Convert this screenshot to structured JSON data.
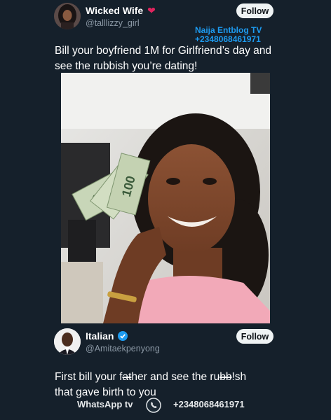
{
  "tweet": {
    "user_name": "Wicked Wife",
    "user_emoji": "❤️",
    "handle": "@talllizzy_girl",
    "follow_label": "Follow",
    "text": "Bill your boyfriend 1M for Girlfriend’s day and see the rubbish you’re dating!"
  },
  "watermark": {
    "line1": "Naija Entblog TV",
    "line2": "+2348068461971"
  },
  "reply": {
    "user_name": "Italian",
    "handle": "@Amitaekpenyong",
    "follow_label": "Follow",
    "text_part1": "First bill your f",
    "text_strike1": "at",
    "text_part2": "her and see the ru",
    "text_strike2": "bb",
    "text_part3": "!sh that gave birth to you"
  },
  "footer": {
    "left_label": "WhatsApp tv",
    "phone": "+2348068461971"
  },
  "colors": {
    "background": "#15202b",
    "accent_blue": "#1d9bf0",
    "verified": "#1d9bf0"
  },
  "icons": [
    "heart-emoji-icon",
    "verified-badge-icon",
    "whatsapp-icon"
  ]
}
